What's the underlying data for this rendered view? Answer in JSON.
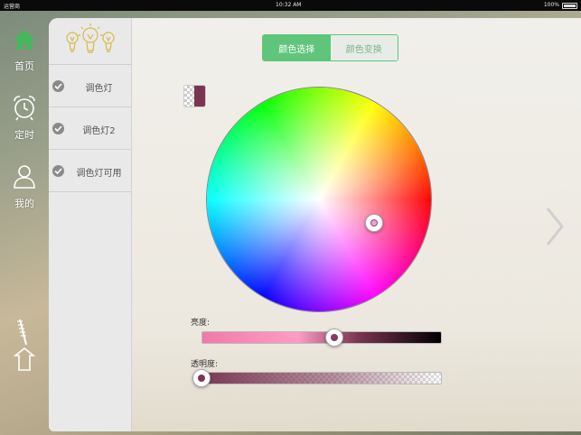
{
  "status_bar": {
    "carrier": "运营商",
    "time": "10:32 AM",
    "battery": "100%"
  },
  "left_nav": {
    "items": [
      {
        "label": "首页",
        "icon": "home-icon"
      },
      {
        "label": "定时",
        "icon": "alarm-clock-icon"
      },
      {
        "label": "我的",
        "icon": "user-icon"
      }
    ],
    "share_icon": "share-icon"
  },
  "device_list": {
    "header_icon": "lightbulbs-icon",
    "items": [
      {
        "label": "调色灯",
        "checked": true
      },
      {
        "label": "调色灯2",
        "checked": true
      },
      {
        "label": "调色灯可用",
        "checked": true
      }
    ]
  },
  "tabs": {
    "items": [
      {
        "label": "颜色选择",
        "active": true
      },
      {
        "label": "颜色变换",
        "active": false
      }
    ]
  },
  "color_picker": {
    "selected_color": "#7a3550",
    "brightness_label": "亮度:",
    "opacity_label": "透明度:",
    "brightness_level": 0.55,
    "opacity_level": 0.0
  },
  "colors": {
    "accent": "#5fc57a",
    "tab_inactive_text": "#7fb48b"
  }
}
